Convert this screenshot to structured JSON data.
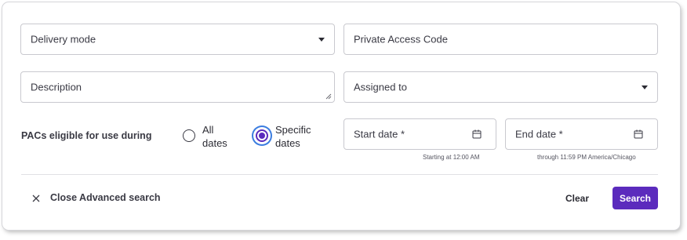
{
  "form": {
    "delivery_mode": {
      "label": "Delivery mode"
    },
    "private_access_code": {
      "placeholder": "Private Access Code"
    },
    "description": {
      "placeholder": "Description"
    },
    "assigned_to": {
      "label": "Assigned to"
    },
    "eligibility": {
      "label": "PACs eligible for use during",
      "options": [
        {
          "line1": "All",
          "line2": "dates",
          "selected": false
        },
        {
          "line1": "Specific",
          "line2": "dates",
          "selected": true
        }
      ]
    },
    "start_date": {
      "label": "Start date *",
      "hint": "Starting at 12:00 AM",
      "icon": "calendar-icon"
    },
    "end_date": {
      "label": "End date *",
      "hint": "through 11:59 PM America/Chicago",
      "icon": "calendar-icon"
    }
  },
  "footer": {
    "close_label": "Close Advanced search",
    "close_icon": "close-icon",
    "clear_label": "Clear",
    "search_label": "Search"
  },
  "colors": {
    "accent": "#5b2bbd",
    "focus_ring": "#3b7de0",
    "border": "#c9c9cf"
  }
}
